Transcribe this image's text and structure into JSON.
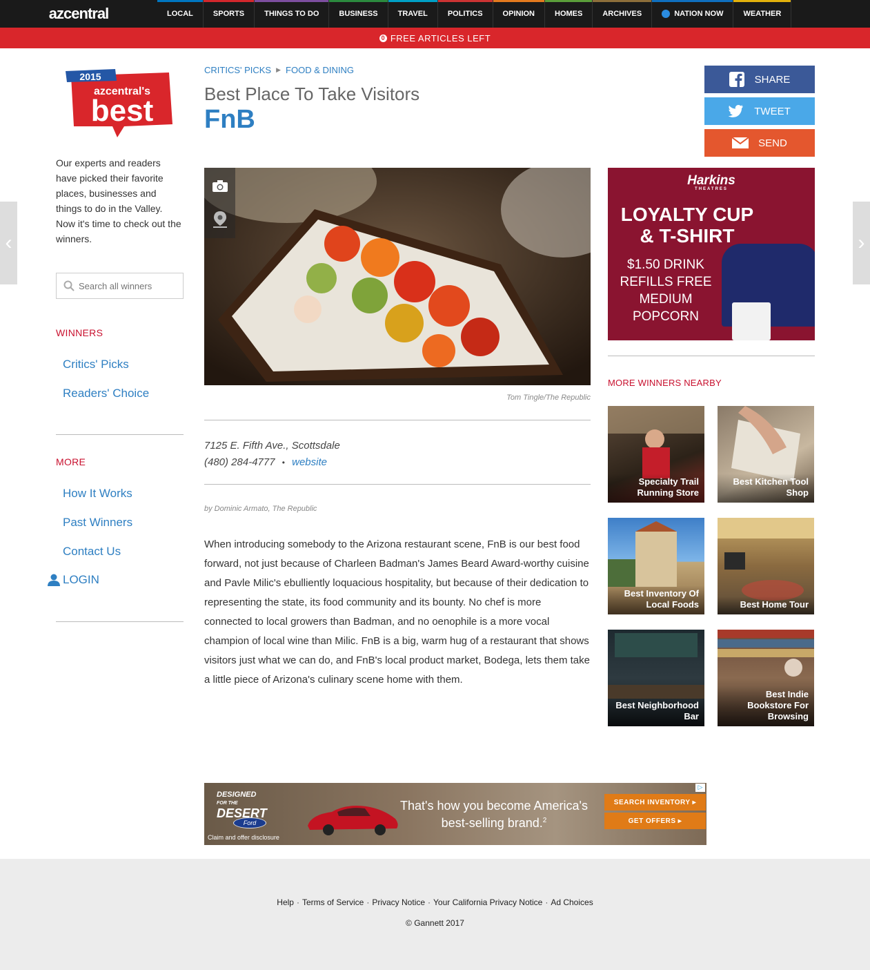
{
  "nav": {
    "logo": "azcentral",
    "items": [
      "LOCAL",
      "SPORTS",
      "THINGS TO DO",
      "BUSINESS",
      "TRAVEL",
      "POLITICS",
      "OPINION",
      "HOMES",
      "ARCHIVES",
      "NATION NOW",
      "WEATHER"
    ]
  },
  "articles_bar": {
    "count": "0",
    "text": "FREE ARTICLES LEFT"
  },
  "logo_badge": {
    "year": "2015",
    "brand": "azcentral's",
    "word": "best"
  },
  "sidebar": {
    "intro": "Our experts and readers have picked their favorite places, businesses and things to do in the Valley. Now it's time to check out the winners.",
    "search_placeholder": "Search all winners",
    "winners_heading": "WINNERS",
    "winners_links": [
      "Critics' Picks",
      "Readers' Choice"
    ],
    "more_heading": "MORE",
    "more_links": [
      "How It Works",
      "Past Winners",
      "Contact Us"
    ],
    "login": "LOGIN"
  },
  "breadcrumb": [
    "CRITICS' PICKS",
    "FOOD & DINING"
  ],
  "article": {
    "category": "Best Place To Take Visitors",
    "title": "FnB",
    "photo_credit": "Tom Tingle/The Republic",
    "address": "7125 E. Fifth Ave., Scottsdale",
    "phone": "(480) 284-4777",
    "separator": "•",
    "website_label": "website",
    "byline": "by Dominic Armato, The Republic",
    "body": "When introducing somebody to the Arizona restaurant scene, FnB is our best food forward, not just because of Charleen Badman's James Beard Award-worthy cuisine and Pavle Milic's ebulliently loquacious hospitality, but because of their dedication to representing the state, its food community and its bounty. No chef is more connected to local growers than Badman, and no oenophile is a more vocal champion of local wine than Milic. FnB is a big, warm hug of a restaurant that shows visitors just what we can do, and FnB's local product market, Bodega, lets them take a little piece of Arizona's culinary scene home with them."
  },
  "share": {
    "buttons": [
      {
        "label": "SHARE",
        "color": "#3b5998",
        "icon": "facebook-icon"
      },
      {
        "label": "TWEET",
        "color": "#4aa8e8",
        "icon": "twitter-icon"
      },
      {
        "label": "SEND",
        "color": "#e4572e",
        "icon": "envelope-icon"
      }
    ]
  },
  "ad_harkins": {
    "brand": "Harkins",
    "brand_sub": "THEATRES",
    "headline": "LOYALTY CUP & T-SHIRT",
    "offer": "$1.50 DRINK REFILLS FREE MEDIUM POPCORN"
  },
  "more_winners": {
    "heading": "MORE WINNERS NEARBY",
    "tiles": [
      {
        "label": "Specialty Trail Running Store"
      },
      {
        "label": "Best Kitchen Tool Shop"
      },
      {
        "label": "Best Inventory Of Local Foods"
      },
      {
        "label": "Best Home Tour"
      },
      {
        "label": "Best Neighborhood Bar"
      },
      {
        "label": "Best Indie Bookstore For Browsing"
      }
    ]
  },
  "ad_ford": {
    "designed": "DESIGNED",
    "for_the": "FOR THE",
    "desert": "DESERT",
    "ford": "Ford",
    "disclosure": "Claim and offer disclosure",
    "tagline": "That's how you become America's best-selling brand.",
    "superscript": "2",
    "btn_search": "SEARCH INVENTORY ▸",
    "btn_offers": "GET OFFERS ▸"
  },
  "footer": {
    "links": [
      "Help",
      "Terms of Service",
      "Privacy Notice",
      "Your California Privacy Notice",
      "Ad Choices"
    ],
    "separator": "·",
    "copyright": "© Gannett 2017"
  }
}
